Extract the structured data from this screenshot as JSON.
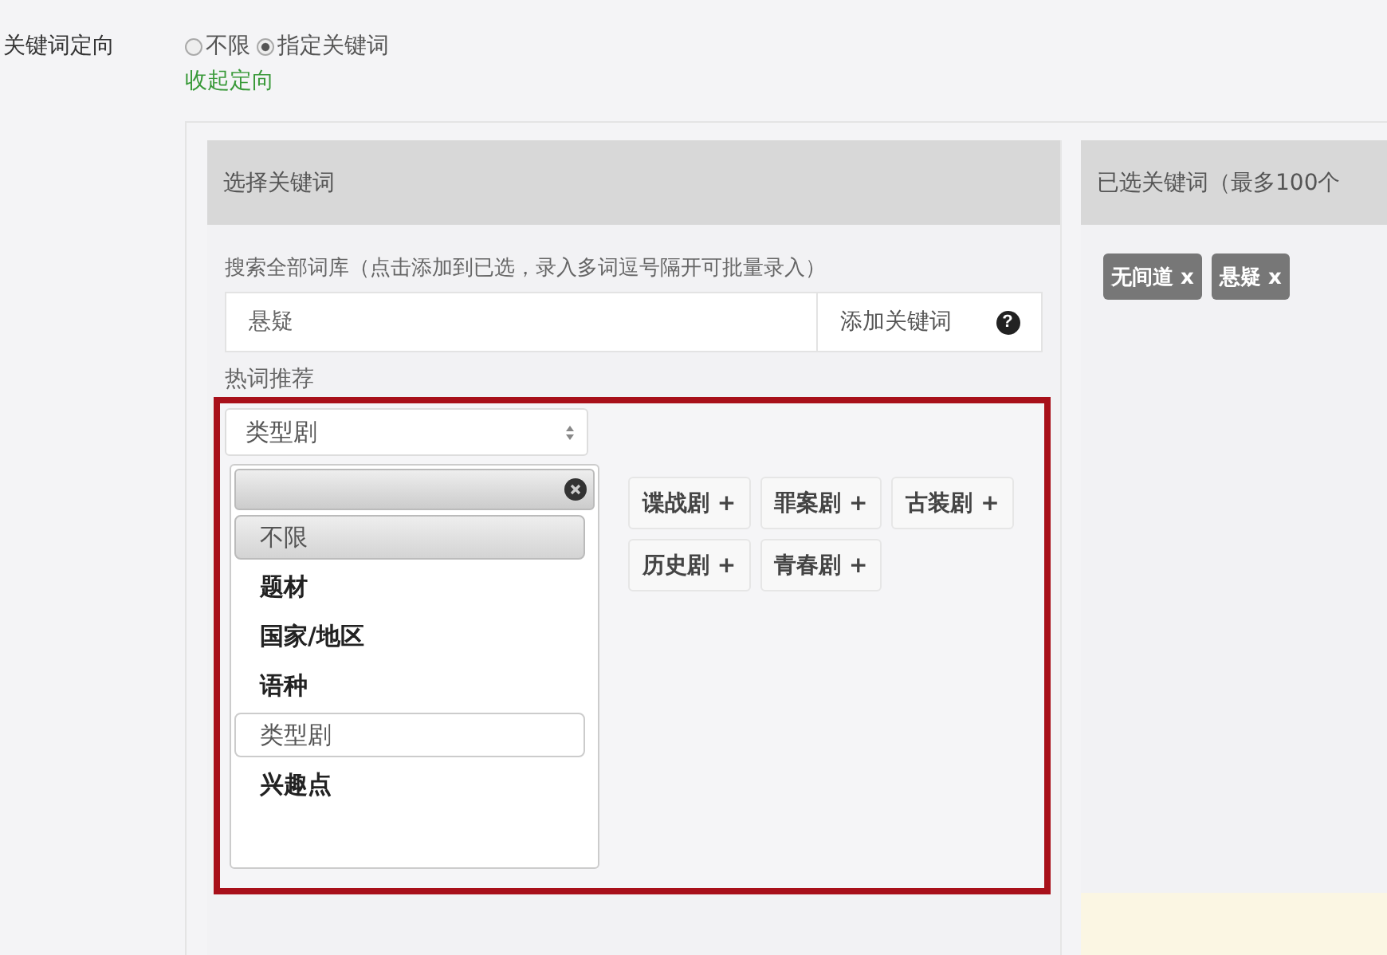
{
  "field_label": "关键词定向",
  "radios": [
    {
      "label": "不限",
      "selected": false
    },
    {
      "label": "指定关键词",
      "selected": true
    }
  ],
  "collapse_link": "收起定向",
  "left_panel": {
    "title": "选择关键词",
    "search_label": "搜索全部词库（点击添加到已选，录入多词逗号隔开可批量录入）",
    "search_value": "悬疑",
    "add_button": "添加关键词",
    "help_icon": "?",
    "hot_label": "热词推荐",
    "select": {
      "value": "类型剧",
      "options": [
        {
          "label": "不限",
          "kind": "option",
          "highlighted": true,
          "selected": false
        },
        {
          "label": "题材",
          "kind": "group",
          "highlighted": false,
          "selected": false
        },
        {
          "label": "国家/地区",
          "kind": "group",
          "highlighted": false,
          "selected": false
        },
        {
          "label": "语种",
          "kind": "group",
          "highlighted": false,
          "selected": false
        },
        {
          "label": "类型剧",
          "kind": "option",
          "highlighted": false,
          "selected": true
        },
        {
          "label": "兴趣点",
          "kind": "group",
          "highlighted": false,
          "selected": false
        }
      ]
    },
    "tag_rows": [
      [
        "谍战剧 +",
        "罪案剧 +",
        "古装剧 +"
      ],
      [
        "历史剧 +",
        "青春剧 +"
      ]
    ]
  },
  "right_panel": {
    "title": "已选关键词（最多100个",
    "chips": [
      "无间道 x",
      "悬疑 x"
    ]
  }
}
